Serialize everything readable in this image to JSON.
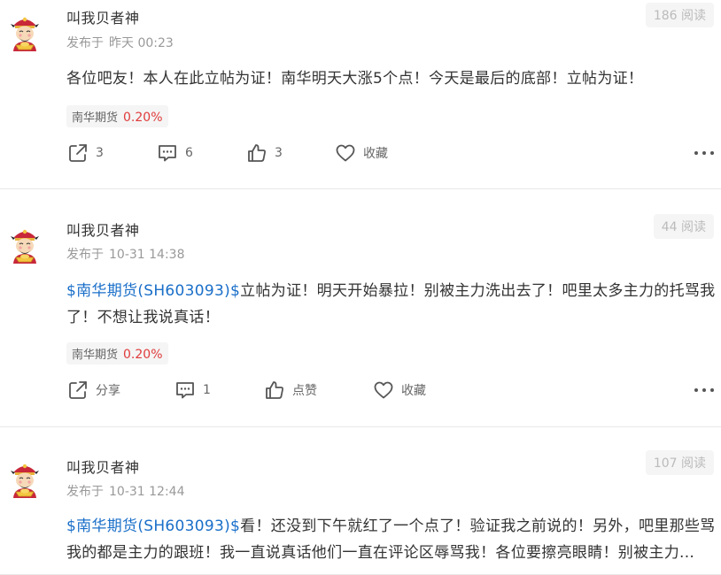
{
  "posts": [
    {
      "author": "叫我贝者神",
      "published_label": "发布于",
      "time": "昨天 00:23",
      "reads": "186 阅读",
      "content_text": "各位吧友！本人在此立帖为证！南华明天大涨5个点！今天是最后的底部！立帖为证！",
      "tag": {
        "name": "南华期货",
        "change": "0.20%"
      },
      "actions": {
        "share": "3",
        "comment": "6",
        "like": "3",
        "collect": "收藏"
      }
    },
    {
      "author": "叫我贝者神",
      "published_label": "发布于",
      "time": "10-31 14:38",
      "reads": "44 阅读",
      "stock_link": "$南华期货(SH603093)$",
      "content_text": "立帖为证！明天开始暴拉！别被主力洗出去了！吧里太多主力的托骂我了！不想让我说真话！",
      "tag": {
        "name": "南华期货",
        "change": "0.20%"
      },
      "actions": {
        "share": "分享",
        "comment": "1",
        "like": "点赞",
        "collect": "收藏"
      }
    },
    {
      "author": "叫我贝者神",
      "published_label": "发布于",
      "time": "10-31 12:44",
      "reads": "107 阅读",
      "stock_link": "$南华期货(SH603093)$",
      "content_text": "看！还没到下午就红了一个点了！验证我之前说的！另外，吧里那些骂我的都是主力的跟班！我一直说真话他们一直在评论区辱骂我！各位要擦亮眼睛！别被主力..."
    }
  ],
  "colors": {
    "link": "#1a6fc9",
    "positive": "#e03b3b",
    "muted": "#999999"
  },
  "icons": [
    "avatar-god-of-wealth",
    "share-icon",
    "comment-icon",
    "like-icon",
    "heart-icon",
    "more-icon"
  ]
}
